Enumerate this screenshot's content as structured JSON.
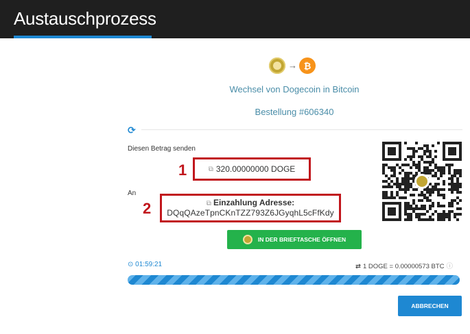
{
  "header": {
    "title": "Austauschprozess"
  },
  "exchange": {
    "from_coin": "doge-coin-icon",
    "to_coin": "bitcoin-icon",
    "arrow": "→",
    "btc_symbol": "₿",
    "title": "Wechsel von Dogecoin in Bitcoin",
    "order": "Bestellung #606340"
  },
  "send": {
    "label": "Diesen Betrag senden",
    "amount": "320.00000000 DOGE",
    "marker": "1"
  },
  "address": {
    "to_label": "An",
    "title": "Einzahlung Adresse:",
    "value": "DQqQAzeTpnCKnTZZ793Z6JGyqhL5cFfKdy",
    "marker": "2"
  },
  "wallet_button": {
    "label": "IN DER BRIEFTASCHE ÖFFNEN"
  },
  "status": {
    "timer": "01:59:21",
    "rate": "1 DOGE = 0.00000573 BTC"
  },
  "progress": {
    "fraction": 1.0
  },
  "cancel_button": {
    "label": "ABBRECHEN"
  },
  "colors": {
    "accent": "#1e88d2",
    "green": "#24b24b",
    "highlight": "#c1161c",
    "doge": "#c2a633",
    "btc": "#f7931a"
  }
}
